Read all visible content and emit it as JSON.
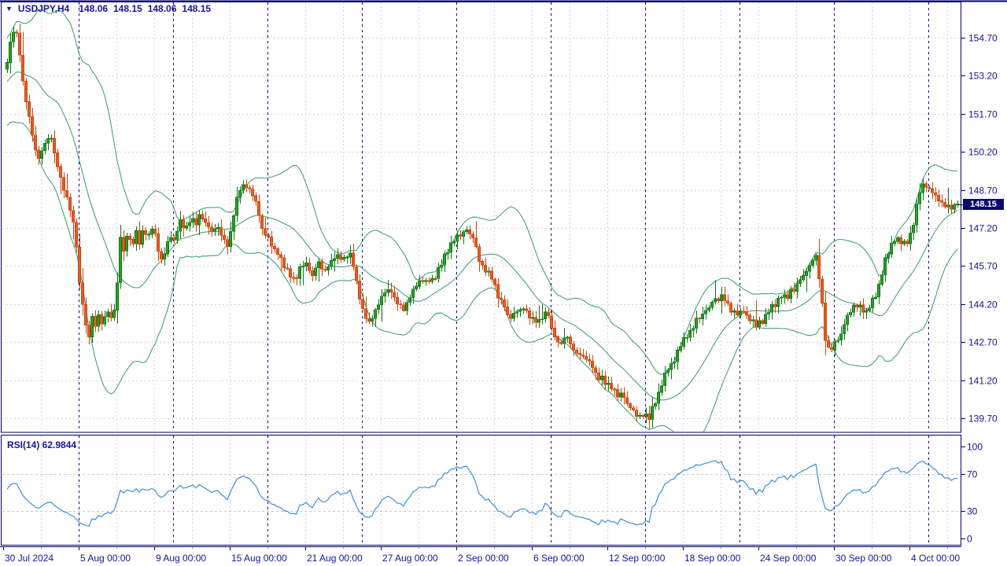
{
  "header": {
    "collapse_icon": "▼",
    "symbol_period": "USDJPY,H4",
    "open": "148.06",
    "high": "148.15",
    "low": "148.06",
    "close": "148.15"
  },
  "price_axis": {
    "labels": [
      "154.70",
      "153.20",
      "151.70",
      "150.20",
      "148.70",
      "147.20",
      "145.70",
      "144.20",
      "142.70",
      "141.20",
      "139.70"
    ],
    "values": [
      154.7,
      153.2,
      151.7,
      150.2,
      148.7,
      147.2,
      145.7,
      144.2,
      142.7,
      141.2,
      139.7
    ],
    "badge": "148.15"
  },
  "rsi_panel": {
    "label": "RSI(14) 62.9844",
    "axis_labels": [
      "100",
      "70",
      "30",
      "0"
    ],
    "axis_values": [
      100,
      70,
      30,
      0
    ],
    "level_lines": [
      70,
      30
    ]
  },
  "time_axis": {
    "labels": [
      "30 Jul 2024",
      "5 Aug 00:00",
      "9 Aug 00:00",
      "15 Aug 00:00",
      "21 Aug 00:00",
      "27 Aug 00:00",
      "2 Sep 00:00",
      "6 Sep 00:00",
      "12 Sep 00:00",
      "18 Sep 00:00",
      "24 Sep 00:00",
      "30 Sep 00:00",
      "4 Oct 00:00"
    ]
  },
  "colors": {
    "bull": "#2ba12b",
    "bull_stroke": "#117311",
    "bear": "#ea5c22",
    "bear_stroke": "#c64511",
    "band": "#45a379",
    "rsi": "#3f8fdc",
    "navy_text": "#14149c",
    "frame": "#000066",
    "grid_gray": "#d6d6d6",
    "navy_dash": "#00008c",
    "badge_bg": "#0a0a6e",
    "badge_text": "#ffffff"
  },
  "chart_data": {
    "type": "candlestick",
    "symbol": "USDJPY",
    "timeframe": "H4",
    "title": "USDJPY,H4 148.06 148.15 148.06 148.15",
    "current_bar": {
      "open": 148.06,
      "high": 148.15,
      "low": 148.06,
      "close": 148.15
    },
    "price_axis": {
      "min": 139.7,
      "max": 154.7,
      "step": 1.5
    },
    "time_labels": [
      "30 Jul 2024",
      "5 Aug 00:00",
      "9 Aug 00:00",
      "15 Aug 00:00",
      "21 Aug 00:00",
      "27 Aug 00:00",
      "2 Sep 00:00",
      "6 Sep 00:00",
      "12 Sep 00:00",
      "18 Sep 00:00",
      "24 Sep 00:00",
      "30 Sep 00:00",
      "4 Oct 00:00"
    ],
    "indicators": [
      {
        "name": "Bollinger Bands",
        "period": 20,
        "deviation": 2,
        "applied": "close"
      },
      {
        "name": "RSI",
        "period": 14,
        "value": 62.9844,
        "scale": [
          0,
          100
        ],
        "levels": [
          30,
          70
        ]
      }
    ],
    "close_path_anchors": [
      [
        6,
        153.3
      ],
      [
        10,
        154.0
      ],
      [
        15,
        154.8
      ],
      [
        19,
        155.1
      ],
      [
        24,
        154.2
      ],
      [
        30,
        152.8
      ],
      [
        36,
        151.7
      ],
      [
        44,
        150.4
      ],
      [
        50,
        149.9
      ],
      [
        57,
        150.5
      ],
      [
        64,
        150.9
      ],
      [
        72,
        149.7
      ],
      [
        80,
        148.8
      ],
      [
        88,
        148.2
      ],
      [
        96,
        146.8
      ],
      [
        100,
        145.2
      ],
      [
        104,
        144.4
      ],
      [
        108,
        143.6
      ],
      [
        112,
        142.5
      ],
      [
        116,
        143.9
      ],
      [
        120,
        143.2
      ],
      [
        125,
        143.8
      ],
      [
        130,
        143.3
      ],
      [
        135,
        144.0
      ],
      [
        140,
        143.6
      ],
      [
        144,
        143.8
      ],
      [
        148,
        144.3
      ],
      [
        152,
        147.0
      ],
      [
        157,
        146.2
      ],
      [
        162,
        147.0
      ],
      [
        167,
        146.4
      ],
      [
        172,
        147.2
      ],
      [
        177,
        146.7
      ],
      [
        182,
        147.2
      ],
      [
        188,
        146.9
      ],
      [
        194,
        147.2
      ],
      [
        200,
        146.5
      ],
      [
        205,
        146.0
      ],
      [
        210,
        146.4
      ],
      [
        215,
        146.9
      ],
      [
        220,
        146.6
      ],
      [
        225,
        147.2
      ],
      [
        230,
        147.5
      ],
      [
        236,
        147.2
      ],
      [
        242,
        147.6
      ],
      [
        248,
        147.4
      ],
      [
        254,
        147.8
      ],
      [
        260,
        147.4
      ],
      [
        268,
        147.1
      ],
      [
        276,
        147.3
      ],
      [
        282,
        146.8
      ],
      [
        288,
        146.5
      ],
      [
        294,
        147.2
      ],
      [
        300,
        148.4
      ],
      [
        306,
        148.8
      ],
      [
        314,
        148.8
      ],
      [
        320,
        148.6
      ],
      [
        327,
        147.9
      ],
      [
        336,
        146.9
      ],
      [
        344,
        146.6
      ],
      [
        352,
        146.2
      ],
      [
        360,
        145.8
      ],
      [
        368,
        145.4
      ],
      [
        374,
        145.1
      ],
      [
        380,
        145.5
      ],
      [
        388,
        145.9
      ],
      [
        396,
        145.3
      ],
      [
        404,
        145.8
      ],
      [
        412,
        145.5
      ],
      [
        420,
        145.9
      ],
      [
        428,
        146.2
      ],
      [
        436,
        146.0
      ],
      [
        444,
        146.3
      ],
      [
        450,
        145.6
      ],
      [
        456,
        144.6
      ],
      [
        462,
        143.8
      ],
      [
        468,
        143.5
      ],
      [
        474,
        143.8
      ],
      [
        480,
        144.1
      ],
      [
        488,
        144.6
      ],
      [
        496,
        144.8
      ],
      [
        504,
        144.3
      ],
      [
        512,
        144.0
      ],
      [
        520,
        144.5
      ],
      [
        528,
        145.0
      ],
      [
        536,
        145.2
      ],
      [
        544,
        145.0
      ],
      [
        552,
        145.3
      ],
      [
        560,
        145.7
      ],
      [
        568,
        146.3
      ],
      [
        576,
        146.7
      ],
      [
        584,
        147.0
      ],
      [
        592,
        147.1
      ],
      [
        600,
        146.9
      ],
      [
        608,
        146.1
      ],
      [
        616,
        145.6
      ],
      [
        624,
        145.2
      ],
      [
        632,
        144.6
      ],
      [
        640,
        144.1
      ],
      [
        648,
        143.6
      ],
      [
        656,
        143.9
      ],
      [
        664,
        144.1
      ],
      [
        672,
        143.8
      ],
      [
        680,
        143.4
      ],
      [
        688,
        143.6
      ],
      [
        696,
        143.9
      ],
      [
        704,
        142.9
      ],
      [
        712,
        142.6
      ],
      [
        720,
        142.9
      ],
      [
        728,
        142.5
      ],
      [
        736,
        142.2
      ],
      [
        744,
        142.0
      ],
      [
        752,
        141.7
      ],
      [
        760,
        141.4
      ],
      [
        768,
        141.1
      ],
      [
        776,
        140.9
      ],
      [
        784,
        140.7
      ],
      [
        792,
        140.5
      ],
      [
        800,
        140.2
      ],
      [
        808,
        139.9
      ],
      [
        816,
        139.8
      ],
      [
        824,
        139.7
      ],
      [
        832,
        140.3
      ],
      [
        840,
        141.0
      ],
      [
        848,
        141.6
      ],
      [
        856,
        142.0
      ],
      [
        864,
        142.5
      ],
      [
        872,
        142.9
      ],
      [
        880,
        143.2
      ],
      [
        888,
        143.7
      ],
      [
        896,
        143.9
      ],
      [
        904,
        144.2
      ],
      [
        912,
        144.4
      ],
      [
        918,
        144.6
      ],
      [
        926,
        144.1
      ],
      [
        934,
        143.8
      ],
      [
        942,
        144.0
      ],
      [
        950,
        143.7
      ],
      [
        958,
        143.5
      ],
      [
        966,
        143.4
      ],
      [
        974,
        143.8
      ],
      [
        982,
        144.1
      ],
      [
        990,
        144.4
      ],
      [
        998,
        144.5
      ],
      [
        1006,
        144.7
      ],
      [
        1014,
        145.0
      ],
      [
        1022,
        145.4
      ],
      [
        1030,
        145.8
      ],
      [
        1038,
        146.0
      ],
      [
        1044,
        144.6
      ],
      [
        1048,
        142.9
      ],
      [
        1054,
        142.3
      ],
      [
        1060,
        142.6
      ],
      [
        1068,
        143.0
      ],
      [
        1076,
        143.6
      ],
      [
        1084,
        144.0
      ],
      [
        1092,
        144.1
      ],
      [
        1100,
        143.9
      ],
      [
        1108,
        144.2
      ],
      [
        1116,
        144.9
      ],
      [
        1124,
        145.8
      ],
      [
        1132,
        146.5
      ],
      [
        1140,
        146.9
      ],
      [
        1148,
        146.6
      ],
      [
        1156,
        146.8
      ],
      [
        1162,
        147.6
      ],
      [
        1168,
        148.5
      ],
      [
        1174,
        149.0
      ],
      [
        1180,
        148.8
      ],
      [
        1188,
        148.5
      ],
      [
        1196,
        148.2
      ],
      [
        1204,
        148.0
      ],
      [
        1210,
        148.1
      ],
      [
        1214,
        148.15
      ]
    ]
  }
}
